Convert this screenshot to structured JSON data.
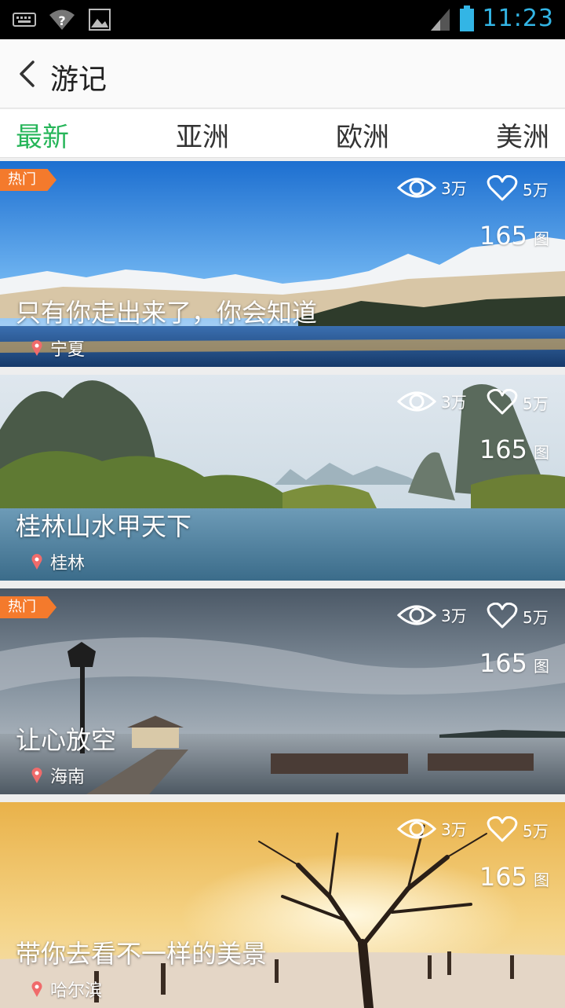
{
  "status_bar": {
    "time": "11:23",
    "icons": [
      "keyboard-icon",
      "wifi-question-icon",
      "image-icon",
      "signal-icon",
      "battery-icon"
    ]
  },
  "header": {
    "title": "游记",
    "back_icon": "chevron-left-icon"
  },
  "tabs": [
    {
      "label": "最新",
      "active": true
    },
    {
      "label": "亚洲",
      "active": false
    },
    {
      "label": "欧洲",
      "active": false
    },
    {
      "label": "美洲",
      "active": false
    }
  ],
  "colors": {
    "accent": "#26b559",
    "badge": "#f47a2c",
    "location_pin": "#f06b6b",
    "status_text": "#33b5e5"
  },
  "cards": [
    {
      "badge": "热门",
      "views": "3万",
      "likes": "5万",
      "pic_count": "165",
      "pic_unit": "图",
      "title": "只有你走出来了，你会知道",
      "location": "宁夏"
    },
    {
      "badge": "",
      "views": "3万",
      "likes": "5万",
      "pic_count": "165",
      "pic_unit": "图",
      "title": "桂林山水甲天下",
      "location": "桂林"
    },
    {
      "badge": "热门",
      "views": "3万",
      "likes": "5万",
      "pic_count": "165",
      "pic_unit": "图",
      "title": "让心放空",
      "location": "海南"
    },
    {
      "badge": "",
      "views": "3万",
      "likes": "5万",
      "pic_count": "165",
      "pic_unit": "图",
      "title": "带你去看不一样的美景",
      "location": "哈尔滨"
    }
  ]
}
